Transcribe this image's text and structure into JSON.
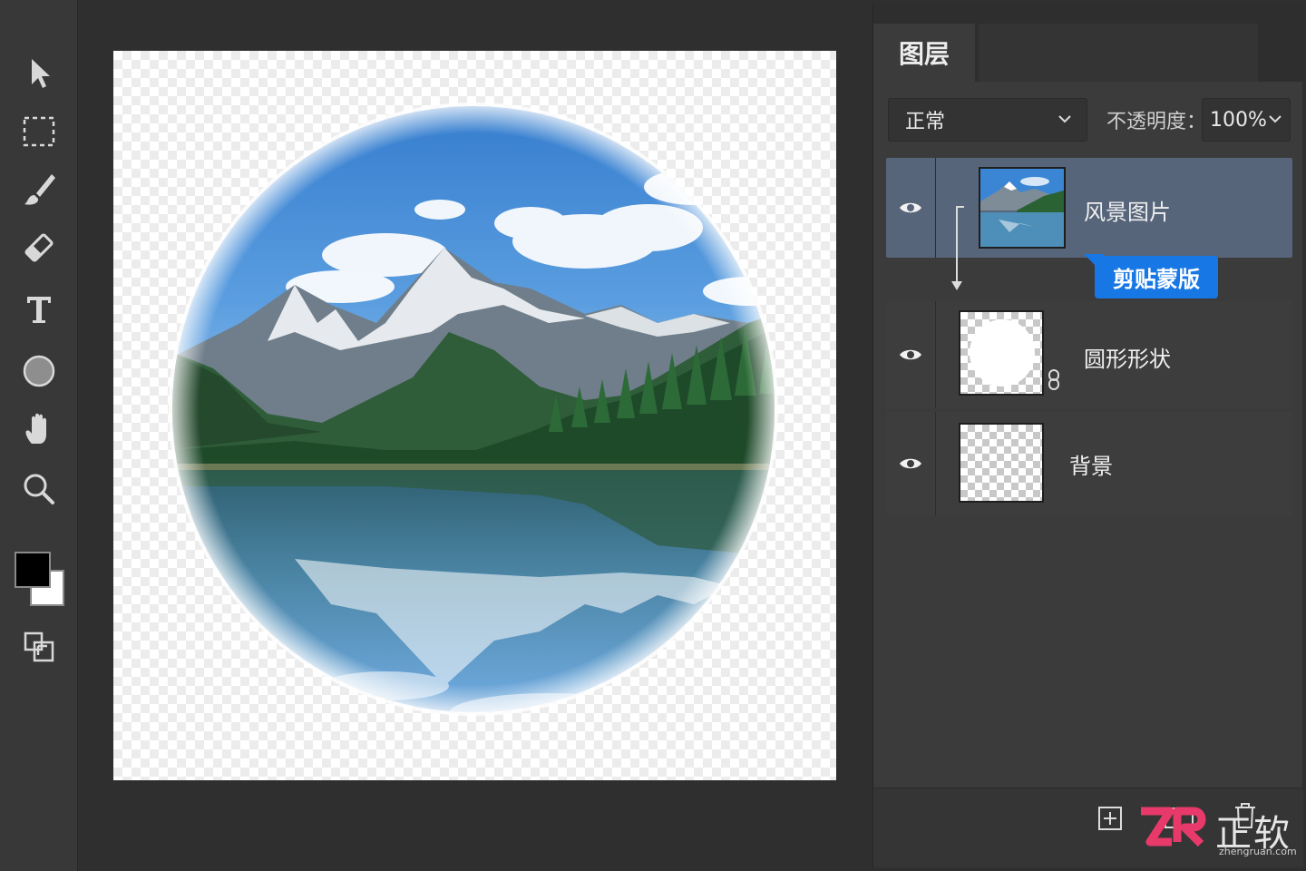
{
  "toolbar": {
    "tools": [
      "move-tool",
      "marquee-tool",
      "brush-tool",
      "eraser-tool",
      "type-tool",
      "ellipse-tool",
      "hand-tool",
      "zoom-tool",
      "arrange-tool"
    ],
    "foreground_color": "#000000",
    "background_color": "#ffffff"
  },
  "layers_panel": {
    "tab_label": "图层",
    "blend_mode": "正常",
    "opacity_label": "不透明度：",
    "opacity_value": "100%",
    "layers": [
      {
        "name": "风景图片",
        "visible": true,
        "selected": true,
        "clipped": true
      },
      {
        "name": "圆形形状",
        "visible": true,
        "selected": false,
        "linked": true
      },
      {
        "name": "背景",
        "visible": true,
        "selected": false
      }
    ],
    "clip_badge": "剪贴蒙版"
  },
  "watermark": {
    "brand": "正软",
    "url": "zhengruan.com"
  },
  "colors": {
    "accent": "#1677e5",
    "selected_row": "#56657a"
  }
}
